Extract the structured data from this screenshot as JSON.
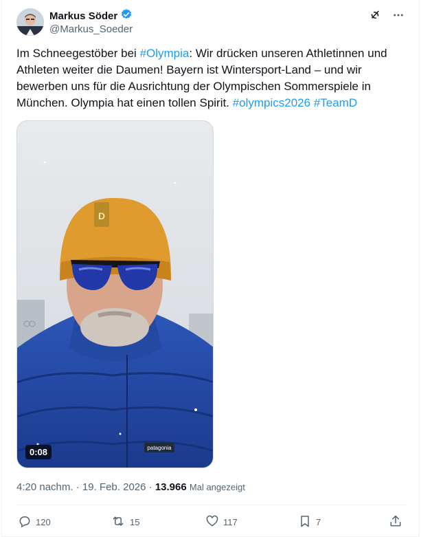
{
  "author": {
    "name": "Markus Söder",
    "handle": "@Markus_Soeder",
    "verified_color": "#1d9bf0"
  },
  "header_icons": [
    "grok-icon",
    "more-icon"
  ],
  "tweet": {
    "segments": [
      {
        "text": "Im Schneegestöber bei ",
        "type": "text"
      },
      {
        "text": "#Olympia",
        "type": "tag"
      },
      {
        "text": ": Wir drücken unseren Athletinnen und Athleten weiter die Daumen! Bayern ist Wintersport-Land – und wir bewerben uns für die Ausrichtung der Olympischen Sommerspiele in München. Olympia hat einen tollen Spirit. ",
        "type": "text"
      },
      {
        "text": "#olympics2026",
        "type": "tag"
      },
      {
        "text": " ",
        "type": "text"
      },
      {
        "text": "#TeamD",
        "type": "tag"
      }
    ]
  },
  "media": {
    "duration": "0:08",
    "jacket_brand": "patagonia"
  },
  "meta": {
    "time": "4:20 nachm.",
    "separator": "·",
    "date": "19. Feb. 2026",
    "views": "13.966",
    "views_label": "Mal angezeigt"
  },
  "actions": {
    "replies": "120",
    "reposts": "15",
    "likes": "117",
    "bookmarks": "7"
  },
  "colors": {
    "link": "#1d9bf0",
    "muted": "#536471",
    "text": "#0f1419"
  }
}
